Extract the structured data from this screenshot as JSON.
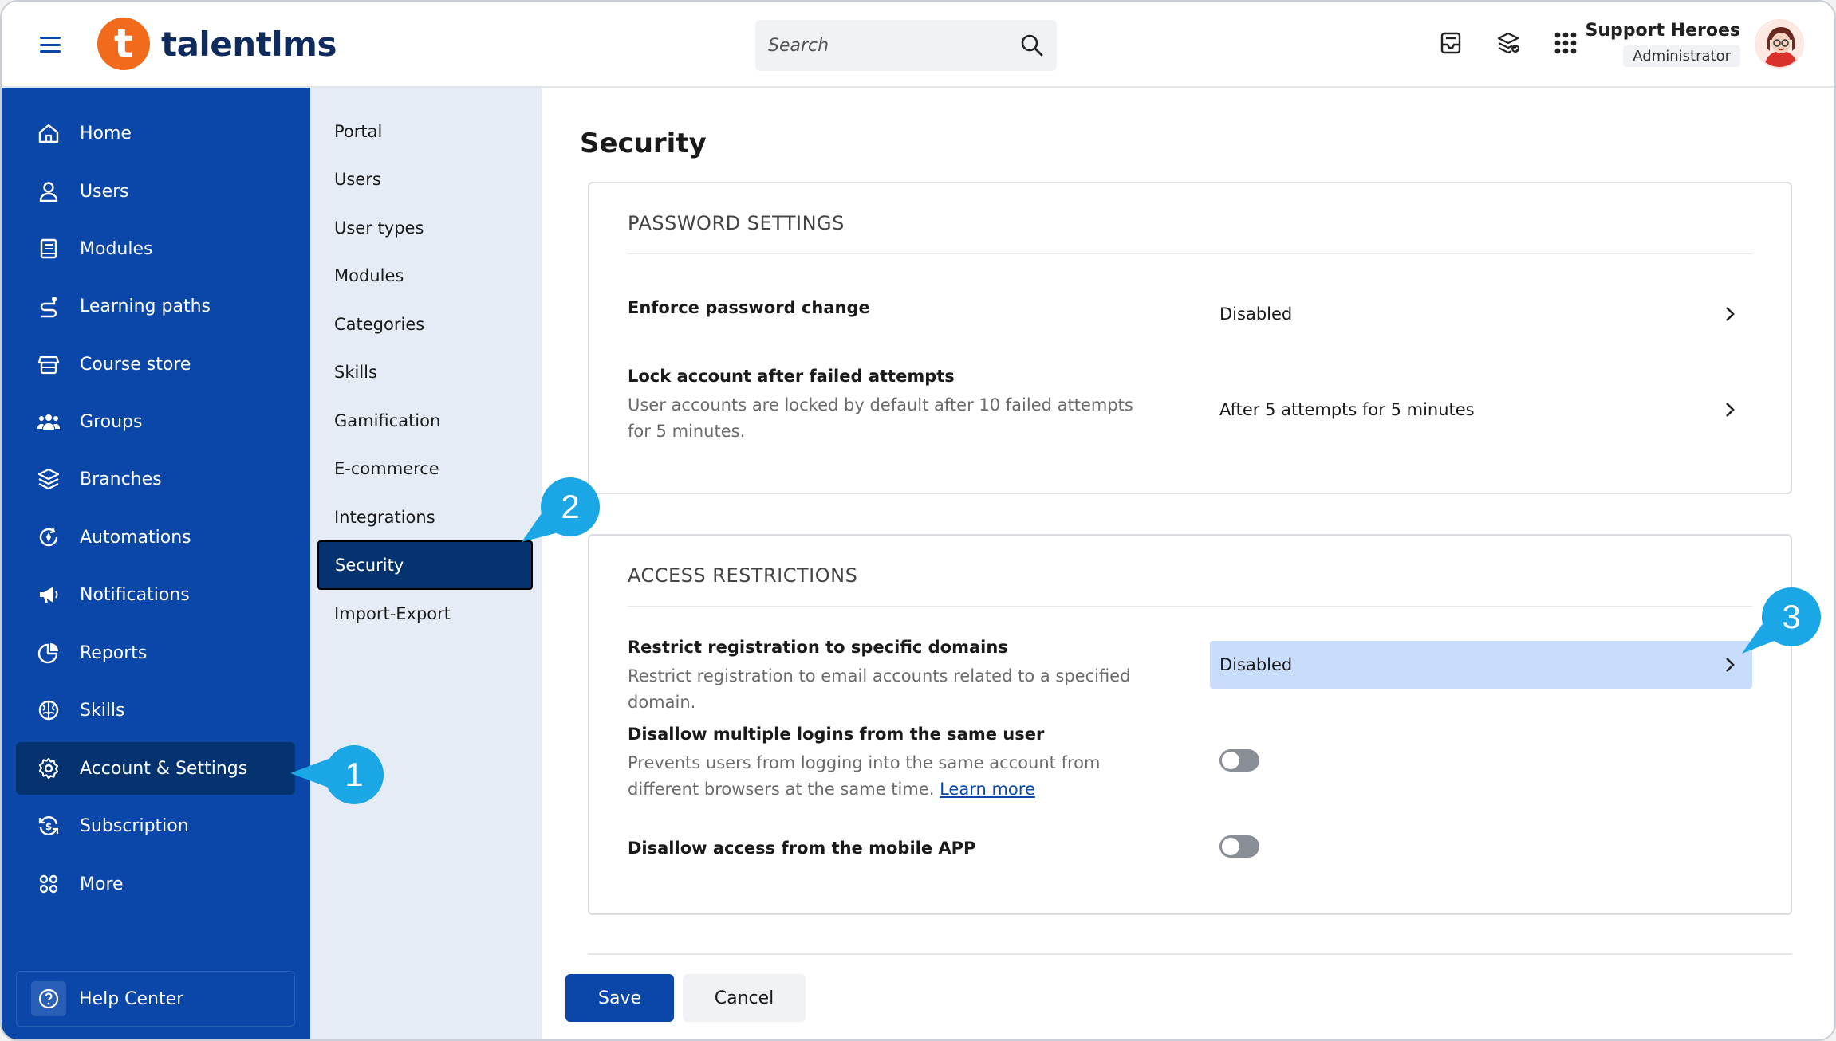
{
  "header": {
    "brand": "talentlms",
    "logo_letter": "t",
    "search_placeholder": "Search",
    "user_name": "Support Heroes",
    "user_role": "Administrator",
    "icons": [
      "inbox-icon",
      "layers-check-icon",
      "apps-grid-icon"
    ]
  },
  "sidebar": {
    "items": [
      {
        "label": "Home",
        "icon": "home-icon"
      },
      {
        "label": "Users",
        "icon": "user-icon"
      },
      {
        "label": "Modules",
        "icon": "book-icon"
      },
      {
        "label": "Learning paths",
        "icon": "path-icon"
      },
      {
        "label": "Course store",
        "icon": "store-icon"
      },
      {
        "label": "Groups",
        "icon": "groups-icon"
      },
      {
        "label": "Branches",
        "icon": "layers-icon"
      },
      {
        "label": "Automations",
        "icon": "automation-icon"
      },
      {
        "label": "Notifications",
        "icon": "megaphone-icon"
      },
      {
        "label": "Reports",
        "icon": "pie-chart-icon"
      },
      {
        "label": "Skills",
        "icon": "brain-icon"
      },
      {
        "label": "Account & Settings",
        "icon": "gear-icon",
        "active": true
      },
      {
        "label": "Subscription",
        "icon": "subscription-icon"
      },
      {
        "label": "More",
        "icon": "more-dots-icon"
      }
    ],
    "help": "Help Center"
  },
  "submenu": {
    "items": [
      "Portal",
      "Users",
      "User types",
      "Modules",
      "Categories",
      "Skills",
      "Gamification",
      "E-commerce",
      "Integrations",
      "Security",
      "Import-Export"
    ],
    "active": "Security"
  },
  "main": {
    "title": "Security",
    "password_settings": {
      "heading": "PASSWORD SETTINGS",
      "enforce_label": "Enforce password change",
      "enforce_value": "Disabled",
      "lock_label": "Lock account after failed attempts",
      "lock_desc": "User accounts are locked by default after 10 failed attempts for 5 minutes.",
      "lock_value": "After 5 attempts for 5 minutes"
    },
    "access_restrictions": {
      "heading": "ACCESS RESTRICTIONS",
      "restrict_label": "Restrict registration to specific domains",
      "restrict_desc": "Restrict registration to email accounts related to a specified domain.",
      "restrict_value": "Disabled",
      "multi_label": "Disallow multiple logins from the same user",
      "multi_desc": "Prevents users from logging into the same account from different browsers at the same time.",
      "multi_link": "Learn more",
      "multi_enabled": false,
      "mobile_label": "Disallow access from the mobile APP",
      "mobile_enabled": false
    },
    "save_label": "Save",
    "cancel_label": "Cancel"
  },
  "callouts": [
    "1",
    "2",
    "3"
  ],
  "colors": {
    "brand_blue": "#0b47a8",
    "active_blue": "#04336f",
    "submenu_bg": "#e6ecf5",
    "highlight": "#c8dcfb",
    "callout": "#1ba6e6",
    "logo_orange": "#f26b1d"
  }
}
